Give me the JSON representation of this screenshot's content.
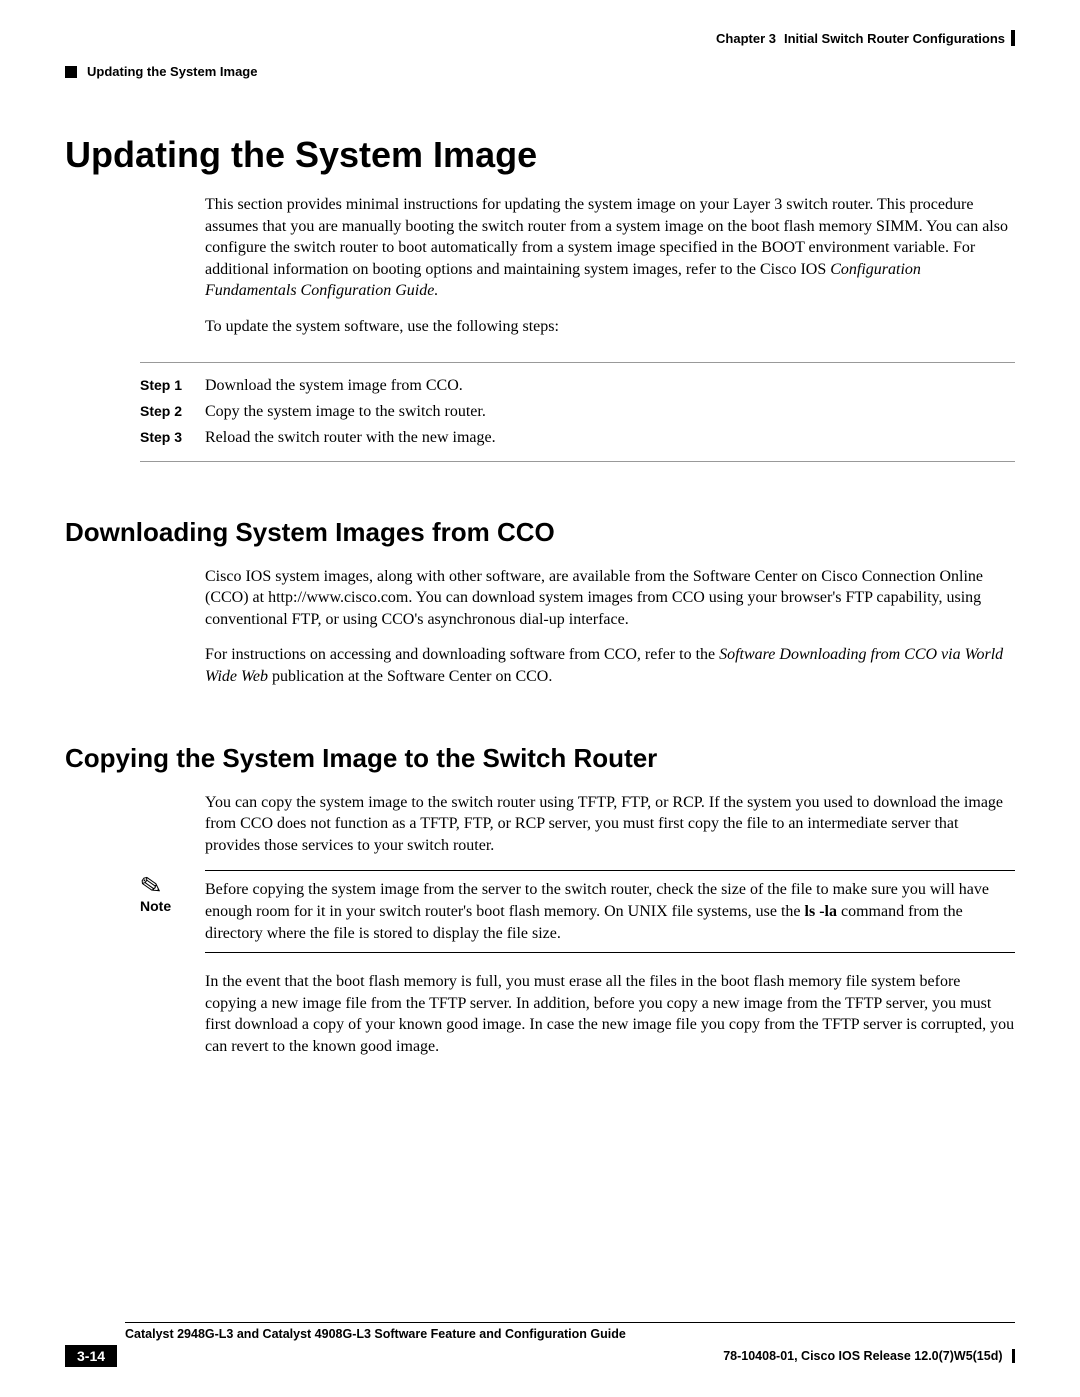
{
  "header": {
    "chapter_label": "Chapter 3",
    "chapter_title": "Initial Switch Router Configurations",
    "section_title": "Updating the System Image"
  },
  "main": {
    "h1": "Updating the System Image",
    "intro_para_a": "This section provides minimal instructions for updating the system image on your Layer 3 switch router. This procedure assumes that you are manually booting the switch router from a system image on the boot flash memory SIMM. You can also configure the switch router to boot automatically from a system image specified in the BOOT environment variable. For additional information on booting options and maintaining system images, refer to the Cisco IOS ",
    "intro_para_italic": "Configuration Fundamentals Configuration Guide.",
    "intro_para2": "To update the system software, use the following steps:",
    "steps": [
      {
        "label": "Step 1",
        "text": "Download the system image from CCO."
      },
      {
        "label": "Step 2",
        "text": "Copy the system image to the switch router."
      },
      {
        "label": "Step 3",
        "text": "Reload the switch router with the new image."
      }
    ],
    "h2a": "Downloading System Images from CCO",
    "cco_p1": "Cisco IOS system images, along with other software, are available from the Software Center on Cisco Connection Online (CCO) at http://www.cisco.com. You can download system images from CCO using your browser's FTP capability, using conventional FTP, or using CCO's asynchronous dial-up interface.",
    "cco_p2_a": "For instructions on accessing and downloading software from CCO, refer to the ",
    "cco_p2_italic": "Software Downloading from CCO via World Wide Web",
    "cco_p2_c": " publication at the Software Center on CCO.",
    "h2b": "Copying the System Image to the Switch Router",
    "copy_p1": "You can copy the system image to the switch router using TFTP, FTP, or RCP. If the system you used to download the image from CCO does not function as a TFTP, FTP, or RCP server, you must first copy the file to an intermediate server that provides those services to your switch router.",
    "note_label": "Note",
    "note_a": "Before copying the system image from the server to the switch router, check the size of the file to make sure you will have enough room for it in your switch router's boot flash memory. On UNIX file systems, use the ",
    "note_cmd": "ls -la",
    "note_b": " command from the directory where the file is stored to display the file size.",
    "copy_p2": "In the event that the boot flash memory is full, you must erase all the files in the boot flash memory file system before copying a new image file from the TFTP server. In addition, before you copy a new image from the TFTP server, you must first download a copy of your known good image. In case the new image file you copy from the TFTP server is corrupted, you can revert to the known good image."
  },
  "footer": {
    "guide_title": "Catalyst 2948G-L3 and Catalyst 4908G-L3 Software Feature and Configuration Guide",
    "page": "3-14",
    "release": "78-10408-01, Cisco IOS Release 12.0(7)W5(15d)"
  }
}
